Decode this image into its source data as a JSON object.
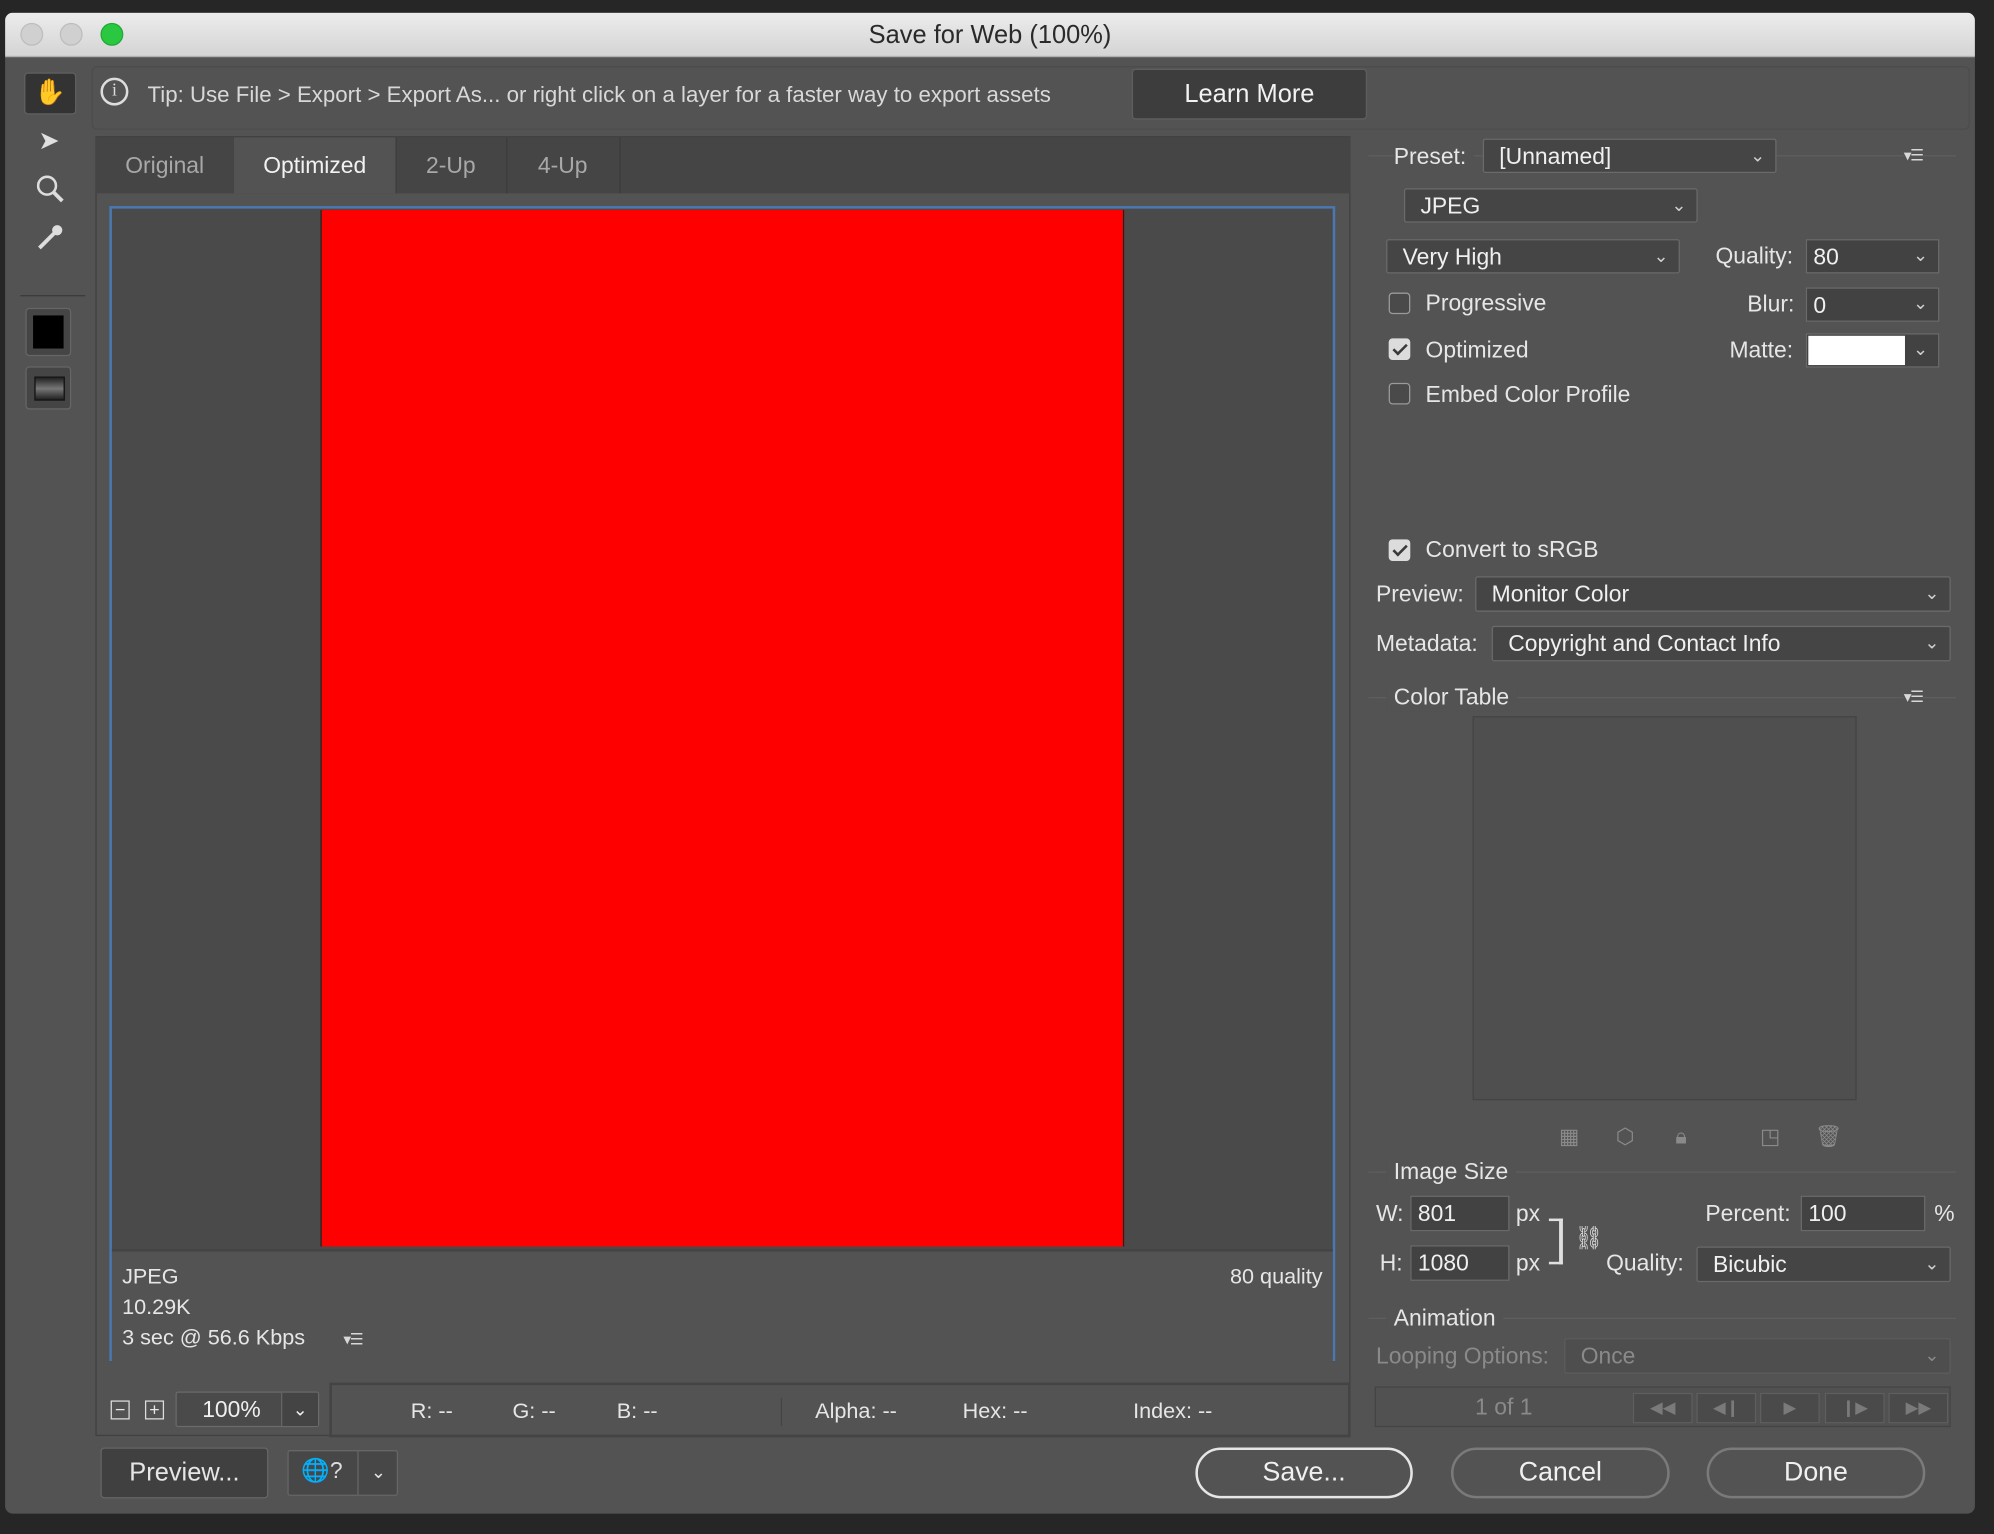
{
  "window": {
    "title": "Save for Web (100%)"
  },
  "tip": {
    "text": "Tip: Use File > Export > Export As...  or right click on a layer for a faster way to export assets",
    "learn_more": "Learn More"
  },
  "tools": [
    "hand-tool",
    "slice-select-tool",
    "zoom-tool",
    "eyedropper-tool",
    "eyedropper-color",
    "toggle-slices-visibility"
  ],
  "tabs": [
    {
      "label": "Original"
    },
    {
      "label": "Optimized",
      "active": true
    },
    {
      "label": "2-Up"
    },
    {
      "label": "4-Up"
    }
  ],
  "preview": {
    "image_color": "#ff0000",
    "format": "JPEG",
    "size": "10.29K",
    "download": "3 sec @ 56.6 Kbps",
    "quality_text": "80 quality"
  },
  "status": {
    "zoom": "100%",
    "r": "R: --",
    "g": "G: --",
    "b": "B: --",
    "alpha": "Alpha: --",
    "hex": "Hex: --",
    "index": "Index: --"
  },
  "buttons": {
    "preview": "Preview...",
    "save": "Save...",
    "cancel": "Cancel",
    "done": "Done"
  },
  "settings": {
    "preset_label": "Preset:",
    "preset": "[Unnamed]",
    "format": "JPEG",
    "quality_preset": "Very High",
    "quality_label": "Quality:",
    "quality": "80",
    "blur_label": "Blur:",
    "blur": "0",
    "matte_label": "Matte:",
    "matte_color": "#ffffff",
    "progressive": {
      "label": "Progressive",
      "checked": false
    },
    "optimized": {
      "label": "Optimized",
      "checked": true
    },
    "embed_profile": {
      "label": "Embed Color Profile",
      "checked": false
    },
    "convert_srgb": {
      "label": "Convert to sRGB",
      "checked": true
    },
    "preview_label": "Preview:",
    "preview_value": "Monitor Color",
    "metadata_label": "Metadata:",
    "metadata_value": "Copyright and Contact Info"
  },
  "color_table": {
    "title": "Color Table"
  },
  "image_size": {
    "title": "Image Size",
    "w_label": "W:",
    "width": "801",
    "h_label": "H:",
    "height": "1080",
    "unit": "px",
    "percent_label": "Percent:",
    "percent": "100",
    "percent_unit": "%",
    "quality_label": "Quality:",
    "quality": "Bicubic"
  },
  "animation": {
    "title": "Animation",
    "looping_label": "Looping Options:",
    "looping": "Once",
    "frame": "1 of 1"
  }
}
